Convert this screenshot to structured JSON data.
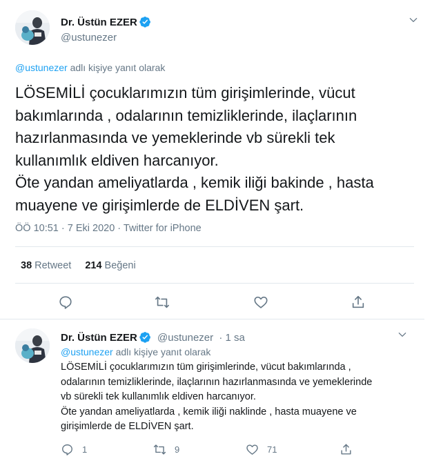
{
  "colors": {
    "accent": "#1da1f2",
    "text": "#14171a",
    "muted": "#657786",
    "divider": "#e1e8ed"
  },
  "main_tweet": {
    "author_name": "Dr. Üstün EZER",
    "handle": "@ustunezer",
    "reply_to_handle": "@ustunezer",
    "reply_to_suffix": "adlı kişiye yanıt olarak",
    "text_lines": [
      "LÖSEMİLİ çocuklarımızın tüm girişimlerinde, vücut",
      "bakımlarında , odalarının temizliklerinde, ilaçlarının",
      "hazırlanmasında ve yemeklerinde vb sürekli tek",
      "kullanımlık eldiven harcanıyor.",
      "Öte yandan ameliyatlarda , kemik iliği bakinde , hasta",
      "muayene ve girişimlerde de ELDİVEN şart."
    ],
    "meta": "ÖÖ 10:51 · 7 Eki 2020 · Twitter for iPhone",
    "retweet_count": "38",
    "retweet_label": "Retweet",
    "like_count": "214",
    "like_label": "Beğeni",
    "icons": [
      "reply-icon",
      "retweet-icon",
      "like-icon",
      "share-icon",
      "chevron-down-icon",
      "verified-badge-icon"
    ]
  },
  "reply_tweet": {
    "author_name": "Dr. Üstün EZER",
    "handle": "@ustunezer",
    "time": "· 1 sa",
    "reply_to_handle": "@ustunezer",
    "reply_to_suffix": "adlı kişiye yanıt olarak",
    "text_lines": [
      "LÖSEMİLİ çocuklarımızın tüm girişimlerinde, vücut bakımlarında ,",
      "odalarının temizliklerinde, ilaçlarının hazırlanmasında ve yemeklerinde",
      "vb sürekli tek kullanımlık eldiven harcanıyor.",
      "Öte yandan ameliyatlarda , kemik iliği naklinde , hasta muayene ve",
      "girişimlerde de ELDİVEN şart."
    ],
    "reply_count": "1",
    "retweet_count": "9",
    "like_count": "71"
  }
}
